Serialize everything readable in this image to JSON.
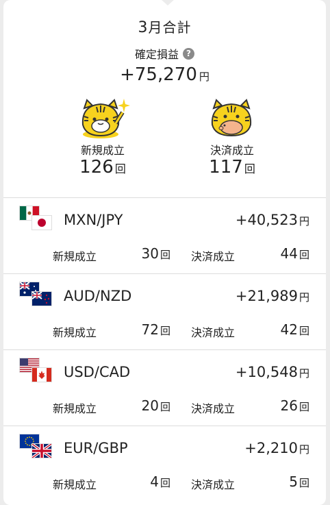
{
  "summary": {
    "month_num": "3",
    "month_suffix": "月合計",
    "pl_label": "確定損益",
    "help_icon": "?",
    "total_value": "+75,270",
    "yen": "円",
    "new_label": "新規成立",
    "new_count": "126",
    "settle_label": "決済成立",
    "settle_count": "117",
    "count_unit": "回"
  },
  "pairs": [
    {
      "name": "MXN/JPY",
      "pl": "+40,523",
      "new_label": "新規成立",
      "new": "30",
      "settle_label": "決済成立",
      "settle": "44",
      "flags": [
        "mexico-flag-icon",
        "japan-flag-icon"
      ]
    },
    {
      "name": "AUD/NZD",
      "pl": "+21,989",
      "new_label": "新規成立",
      "new": "72",
      "settle_label": "決済成立",
      "settle": "42",
      "flags": [
        "australia-flag-icon",
        "new-zealand-flag-icon"
      ]
    },
    {
      "name": "USD/CAD",
      "pl": "+10,548",
      "new_label": "新規成立",
      "new": "20",
      "settle_label": "決済成立",
      "settle": "26",
      "flags": [
        "usa-flag-icon",
        "canada-flag-icon"
      ]
    },
    {
      "name": "EUR/GBP",
      "pl": "+2,210",
      "new_label": "新規成立",
      "new": "4",
      "settle_label": "決済成立",
      "settle": "5",
      "flags": [
        "eu-flag-icon",
        "uk-flag-icon"
      ]
    }
  ],
  "units": {
    "yen": "円",
    "count": "回"
  },
  "colors": {
    "tiger": "#f7d21e",
    "card": "#ffffff",
    "divider": "#dcdcdc"
  }
}
